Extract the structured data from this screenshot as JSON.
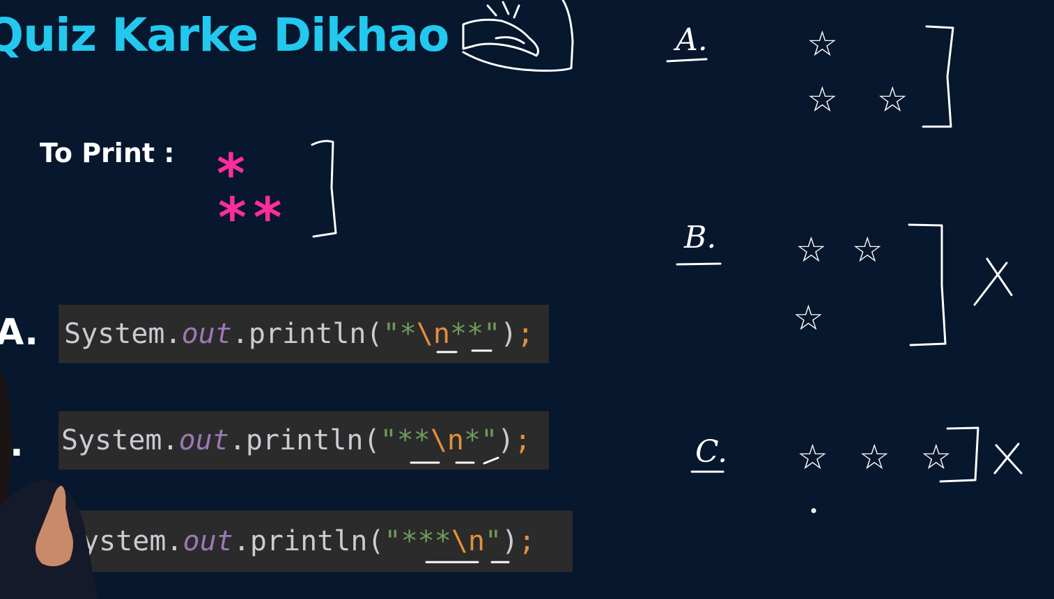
{
  "header": {
    "title": "Quiz Karke Dikhao",
    "badge_icon": "flexed-arm-icon"
  },
  "prompt": {
    "label": "To Print :",
    "pattern_rows": [
      "*",
      "**"
    ],
    "pattern_color": "#ff2d9b"
  },
  "options": [
    {
      "letter": "A.",
      "code": {
        "prefix": "System.",
        "field": "out",
        "method": ".println(",
        "quote_open": "\"",
        "before_escape": "*",
        "escape": "\\n",
        "after_escape": "**",
        "quote_close": "\"",
        "close": ")",
        "semi": ";"
      }
    },
    {
      "letter": ".",
      "code": {
        "prefix": "System.",
        "field": "out",
        "method": ".println(",
        "quote_open": "\"",
        "before_escape": "**",
        "escape": "\\n",
        "after_escape": "*",
        "quote_close": "\"",
        "close": ")",
        "semi": ";"
      }
    },
    {
      "letter": "",
      "code": {
        "prefix": "ystem.",
        "field": "out",
        "method": ".println(",
        "quote_open": "\"",
        "before_escape": "***",
        "escape": "\\n",
        "after_escape": "",
        "quote_close": "\"",
        "close": ")",
        "semi": ";"
      }
    }
  ],
  "whiteboard": {
    "labels": [
      "A.",
      "B.",
      "C."
    ],
    "rows": {
      "a": [
        "☆",
        "☆ ☆"
      ],
      "b": [
        "☆ ☆",
        "☆"
      ],
      "c": [
        "☆ ☆ ☆"
      ]
    },
    "marks": {
      "b": "X",
      "c": "X"
    }
  },
  "colors": {
    "background": "#07172d",
    "title": "#22c8ee",
    "code_bg": "#2b2b2b",
    "string": "#6f9a5a",
    "escape": "#e3903b",
    "field": "#9d78b4"
  }
}
